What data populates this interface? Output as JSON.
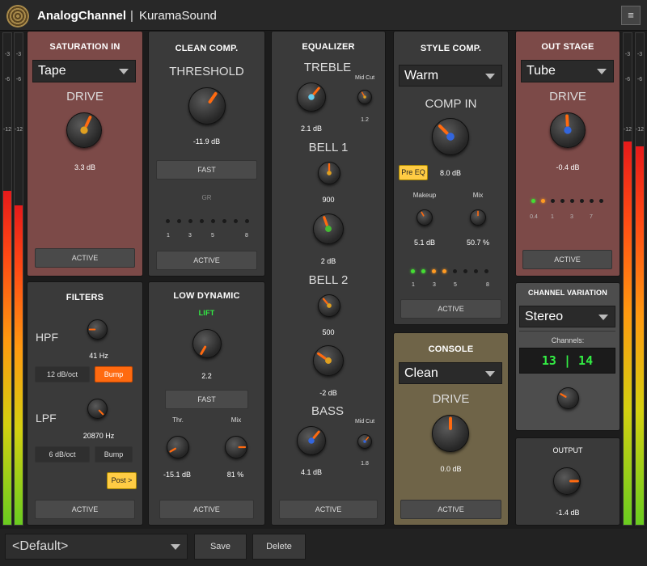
{
  "header": {
    "brand": "AnalogChannel",
    "separator": "|",
    "product": "KuramaSound",
    "menu_icon": "≡"
  },
  "meters": {
    "scale": [
      "-3",
      "-6",
      "-12"
    ],
    "left_levels": [
      0.68,
      0.65
    ],
    "right_levels": [
      0.78,
      0.77
    ]
  },
  "saturation_in": {
    "title": "SATURATION IN",
    "type_value": "Tape",
    "knob_label": "DRIVE",
    "drive_value": "3.3 dB",
    "active_label": "ACTIVE"
  },
  "clean_comp": {
    "title": "CLEAN COMP.",
    "knob_label": "THRESHOLD",
    "threshold_value": "-11.9 dB",
    "fast_label": "FAST",
    "gr_label": "GR",
    "gr_scale": [
      "1",
      "3",
      "5",
      "8"
    ],
    "active_label": "ACTIVE"
  },
  "equalizer": {
    "title": "EQUALIZER",
    "treble_label": "TREBLE",
    "treble_value": "2.1 dB",
    "treble_midcut_label": "Mid Cut",
    "treble_midcut_value": "1.2",
    "bell1_label": "BELL 1",
    "bell1_freq": "900",
    "bell1_gain": "2 dB",
    "bell2_label": "BELL 2",
    "bell2_freq": "500",
    "bell2_gain": "-2 dB",
    "bass_label": "BASS",
    "bass_value": "4.1 dB",
    "bass_midcut_label": "Mid Cut",
    "bass_midcut_value": "1.8",
    "active_label": "ACTIVE"
  },
  "style_comp": {
    "title": "STYLE COMP.",
    "style_value": "Warm",
    "knob_label": "COMP IN",
    "pre_eq_label": "Pre EQ",
    "comp_in_value": "8.0 dB",
    "makeup_label": "Makeup",
    "makeup_value": "5.1 dB",
    "mix_label": "Mix",
    "mix_value": "50.7 %",
    "led_scale": [
      "1",
      "3",
      "5",
      "8"
    ],
    "active_label": "ACTIVE"
  },
  "out_stage": {
    "title": "OUT STAGE",
    "type_value": "Tube",
    "knob_label": "DRIVE",
    "drive_value": "-0.4 dB",
    "led_scale": [
      "0.4",
      "1",
      "3",
      "7"
    ],
    "active_label": "ACTIVE"
  },
  "filters": {
    "title": "FILTERS",
    "hpf_label": "HPF",
    "hpf_value": "41 Hz",
    "hpf_slope": "12 dB/oct",
    "hpf_bump": "Bump",
    "lpf_label": "LPF",
    "lpf_value": "20870 Hz",
    "lpf_slope": "6 dB/oct",
    "lpf_bump": "Bump",
    "post_label": "Post >",
    "active_label": "ACTIVE"
  },
  "low_dynamic": {
    "title": "LOW DYNAMIC",
    "lift_label": "LIFT",
    "lift_value": "2.2",
    "fast_label": "FAST",
    "thr_label": "Thr.",
    "thr_value": "-15.1 dB",
    "mix_label": "Mix",
    "mix_value": "81 %",
    "active_label": "ACTIVE"
  },
  "console": {
    "title": "CONSOLE",
    "type_value": "Clean",
    "knob_label": "DRIVE",
    "drive_value": "0.0 dB",
    "active_label": "ACTIVE"
  },
  "channel_variation": {
    "title": "CHANNEL VARIATION",
    "mode_value": "Stereo",
    "channels_label": "Channels:",
    "channels_value": "13 | 14"
  },
  "output": {
    "title": "OUTPUT",
    "value": "-1.4 dB"
  },
  "footer": {
    "preset_value": "<Default>",
    "save_label": "Save",
    "delete_label": "Delete"
  },
  "colors": {
    "knob_indicator": "#ff6a10",
    "led_green": "#44dd33",
    "led_orange": "#ff9a22",
    "red_panel": "#7c4a48",
    "olive_panel": "#6f6448",
    "channel_readout": "#33ee44"
  }
}
